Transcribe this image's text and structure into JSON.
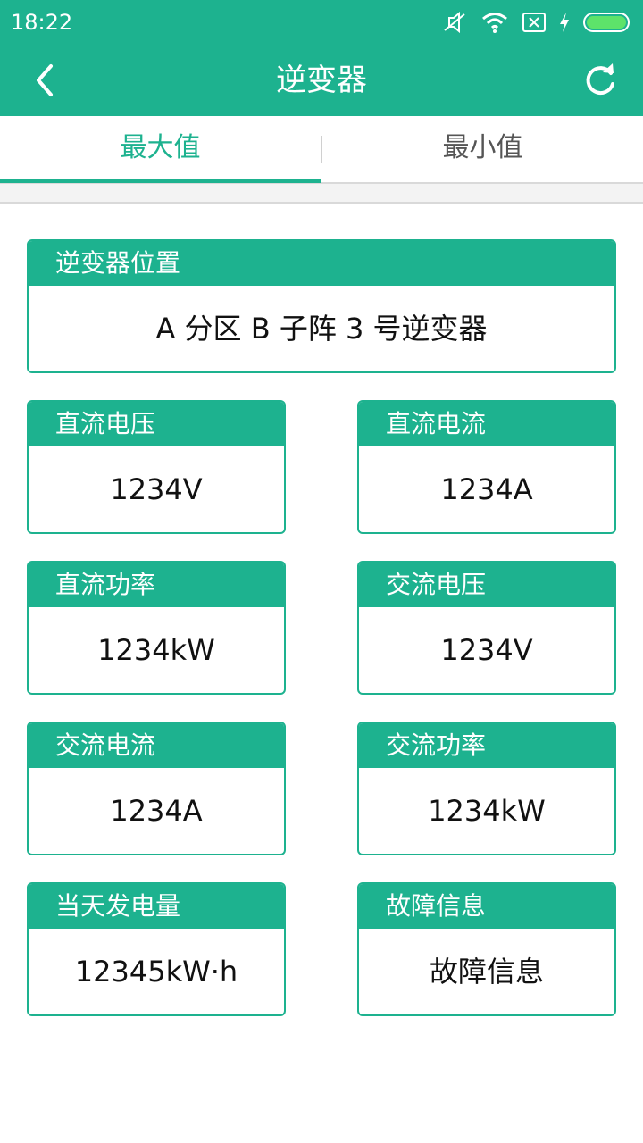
{
  "status_bar": {
    "time": "18:22",
    "icons": [
      "mute-icon",
      "wifi-icon",
      "sim-icon",
      "charging-icon",
      "battery-icon"
    ],
    "battery_color": "#5de36a"
  },
  "app_bar": {
    "title": "逆变器",
    "back_icon": "chevron-left-icon",
    "refresh_icon": "refresh-icon"
  },
  "tabs": [
    {
      "label": "最大值",
      "active": true
    },
    {
      "label": "最小值",
      "active": false
    }
  ],
  "location": {
    "label": "逆变器位置",
    "value": "A 分区 B 子阵 3 号逆变器"
  },
  "metrics": [
    {
      "label": "直流电压",
      "value": "1234V"
    },
    {
      "label": "直流电流",
      "value": "1234A"
    },
    {
      "label": "直流功率",
      "value": "1234kW"
    },
    {
      "label": "交流电压",
      "value": "1234V"
    },
    {
      "label": "交流电流",
      "value": "1234A"
    },
    {
      "label": "交流功率",
      "value": "1234kW"
    },
    {
      "label": "当天发电量",
      "value": "12345kW·h"
    },
    {
      "label": "故障信息",
      "value": "故障信息"
    }
  ],
  "colors": {
    "accent": "#1db28f",
    "text": "#111111",
    "inactive_tab": "#555555"
  }
}
